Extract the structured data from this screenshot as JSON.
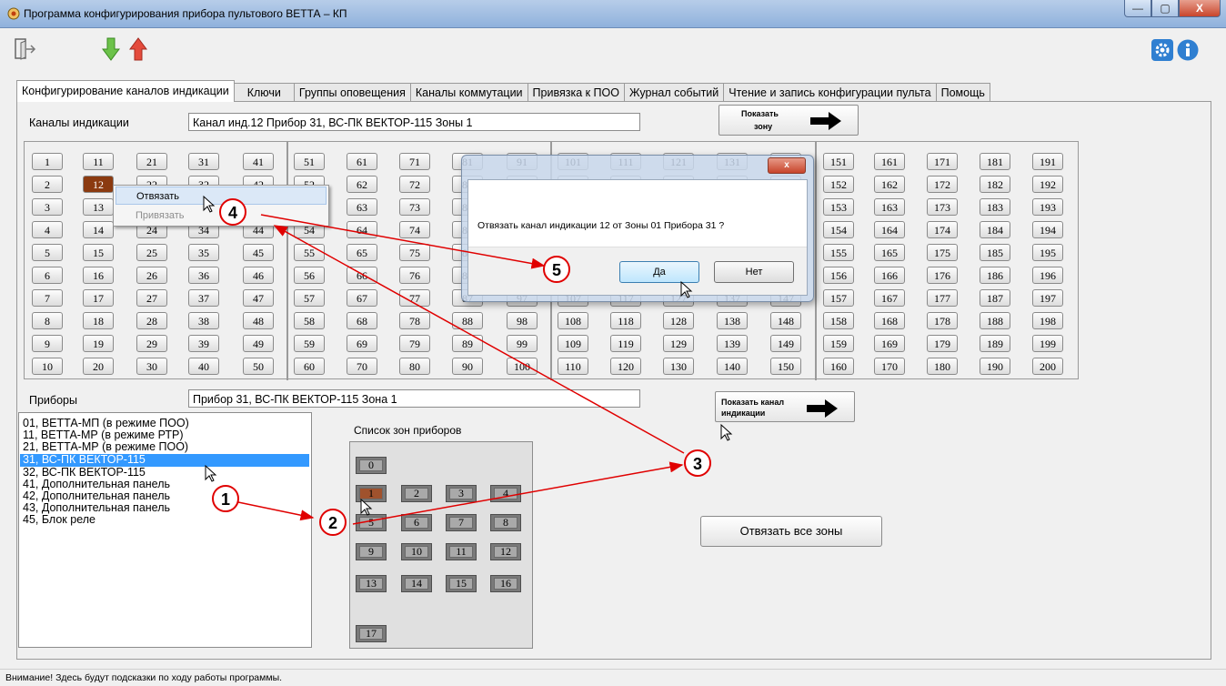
{
  "window": {
    "title": "Программа конфигурирования прибора пультового ВЕТТА – КП",
    "controls": [
      "—",
      "▢",
      "X"
    ]
  },
  "tabs": [
    {
      "label": "Конфигурирование каналов индикации",
      "active": true
    },
    {
      "label": "Ключи",
      "active": false
    },
    {
      "label": "Группы оповещения",
      "active": false
    },
    {
      "label": "Каналы коммутации",
      "active": false
    },
    {
      "label": "Привязка к ПОО",
      "active": false
    },
    {
      "label": "Журнал событий",
      "active": false
    },
    {
      "label": "Чтение и запись конфигурации пульта",
      "active": false
    },
    {
      "label": "Помощь",
      "active": false
    }
  ],
  "channels": {
    "label": "Каналы индикации",
    "field_value": "Канал инд.12 Прибор  31, ВС-ПК ВЕКТОР-115 Зоны  1",
    "show_zone_label_1": "Показать",
    "show_zone_label_2": "зону",
    "selected": 12
  },
  "devices": {
    "label": "Приборы",
    "field_value": "Прибор 31, ВС-ПК ВЕКТОР-115  Зона 1",
    "show_channel_label_1": "Показать канал",
    "show_channel_label_2": "индикации",
    "items": [
      "01, ВЕТТА-МП (в режиме ПОО)",
      "11, ВЕТТА-МР (в режиме РТР)",
      "21, ВЕТТА-МР (в режиме ПОО)",
      "31, ВС-ПК ВЕКТОР-115",
      "32, ВС-ПК ВЕКТОР-115",
      "41, Дополнительная панель",
      "42, Дополнительная панель",
      "43, Дополнительная панель",
      "45, Блок реле"
    ],
    "selected_index": 3
  },
  "zones": {
    "label": "Список зон приборов",
    "selected": 1
  },
  "unbind_all_label": "Отвязать все зоны",
  "context_menu": {
    "unbind": "Отвязать",
    "bind": "Привязать"
  },
  "dialog": {
    "message": "Отвязать канал индикации 12 от Зоны 01 Прибора 31 ?",
    "yes": "Да",
    "no": "Нет",
    "close": "x"
  },
  "callouts": [
    "1",
    "2",
    "3",
    "4",
    "5"
  ],
  "status": "Внимание! Здесь будут подсказки по ходу работы программы.",
  "colors": {
    "selected_channel": "#8b3a10",
    "selected_list": "#3399ff",
    "annotation": "#e00000"
  }
}
